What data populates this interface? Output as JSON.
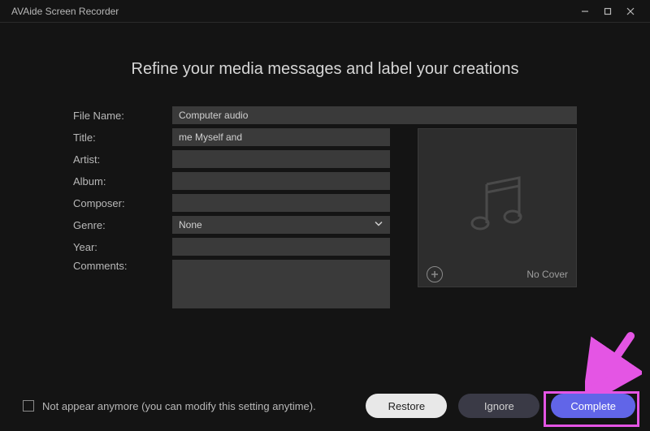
{
  "app_title": "AVAide Screen Recorder",
  "heading": "Refine your media messages and label your creations",
  "labels": {
    "file_name": "File Name:",
    "title": "Title:",
    "artist": "Artist:",
    "album": "Album:",
    "composer": "Composer:",
    "genre": "Genre:",
    "year": "Year:",
    "comments": "Comments:"
  },
  "values": {
    "file_name": "Computer audio",
    "title": "me Myself and ",
    "artist": "",
    "album": "",
    "composer": "",
    "genre": "None",
    "year": "",
    "comments": ""
  },
  "cover": {
    "no_cover": "No Cover"
  },
  "footer": {
    "checkbox_label": "Not appear anymore (you can modify this setting anytime).",
    "restore": "Restore",
    "ignore": "Ignore",
    "complete": "Complete"
  },
  "annotation": {
    "highlight_target": "complete-button",
    "arrow_color": "#e455e4"
  }
}
